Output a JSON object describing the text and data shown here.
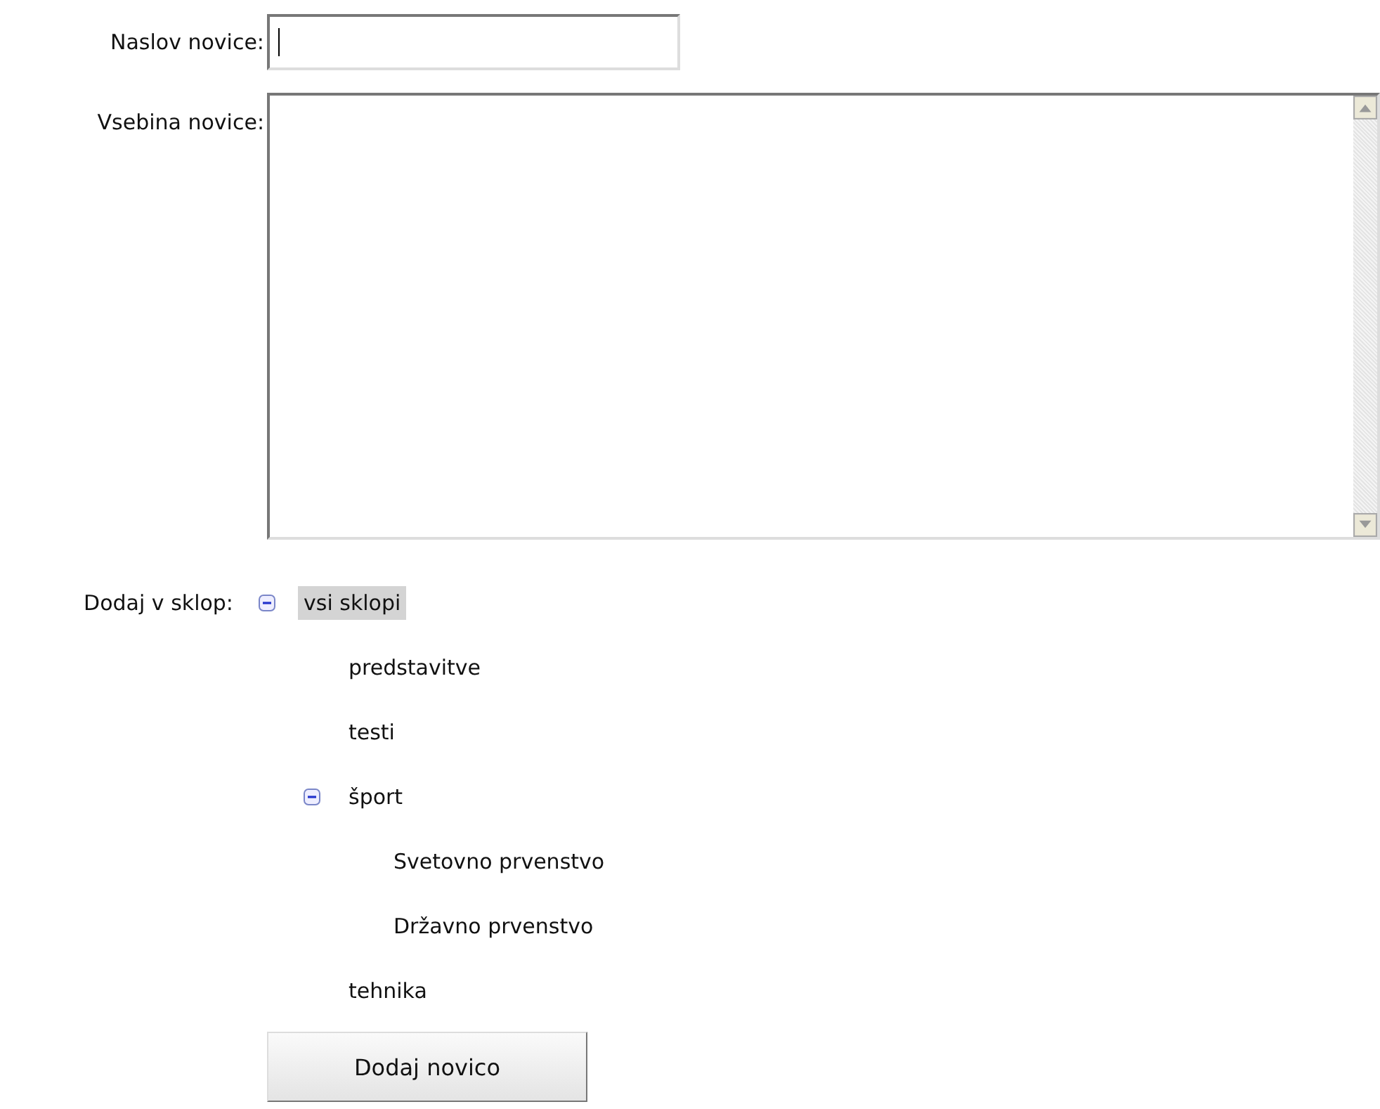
{
  "title_field": {
    "label": "Naslov novice:",
    "focused": true
  },
  "content_field": {
    "label": "Vsebina novice:"
  },
  "category_tree": {
    "label": "Dodaj v sklop:",
    "items": [
      {
        "label": "vsi sklopi",
        "selected": true,
        "expanded": true,
        "children": [
          {
            "label": "predstavitve",
            "selected": false
          },
          {
            "label": "testi",
            "selected": false
          },
          {
            "label": "šport",
            "selected": false,
            "expanded": true,
            "children": [
              {
                "label": "Svetovno prvenstvo",
                "selected": false
              },
              {
                "label": "Državno prvenstvo",
                "selected": false
              }
            ]
          },
          {
            "label": "tehnika",
            "selected": false
          }
        ]
      }
    ]
  },
  "submit_button": {
    "label": "Dodaj novico"
  }
}
